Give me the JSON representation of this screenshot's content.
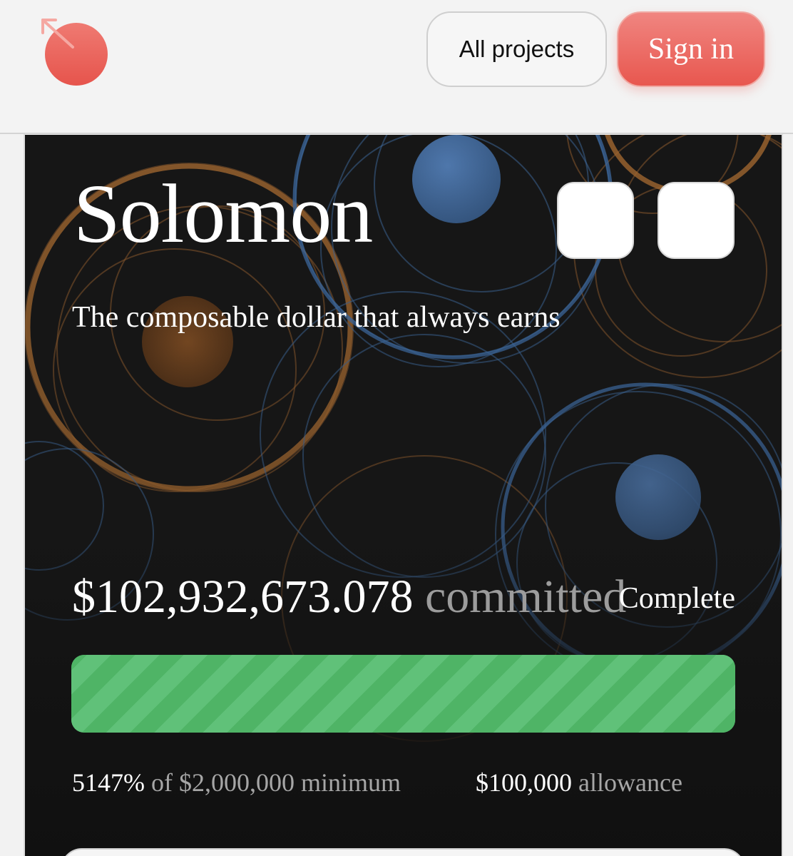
{
  "header": {
    "all_projects_label": "All projects",
    "sign_in_label": "Sign in"
  },
  "project": {
    "name": "Solomon",
    "tagline": "The composable dollar that always earns",
    "amount": "$102,932,673.078",
    "committed_label": "committed",
    "status": "Complete",
    "progress_fraction": 1.0,
    "percent": "5147%",
    "minimum_text": "of $2,000,000 minimum",
    "allowance_amount": "$100,000",
    "allowance_label": "allowance"
  },
  "colors": {
    "accent": "#e8574f",
    "progress": "#52b86a",
    "hero_background": "#141414"
  },
  "icons": {
    "logo": "red-circle-arrow-logo"
  }
}
